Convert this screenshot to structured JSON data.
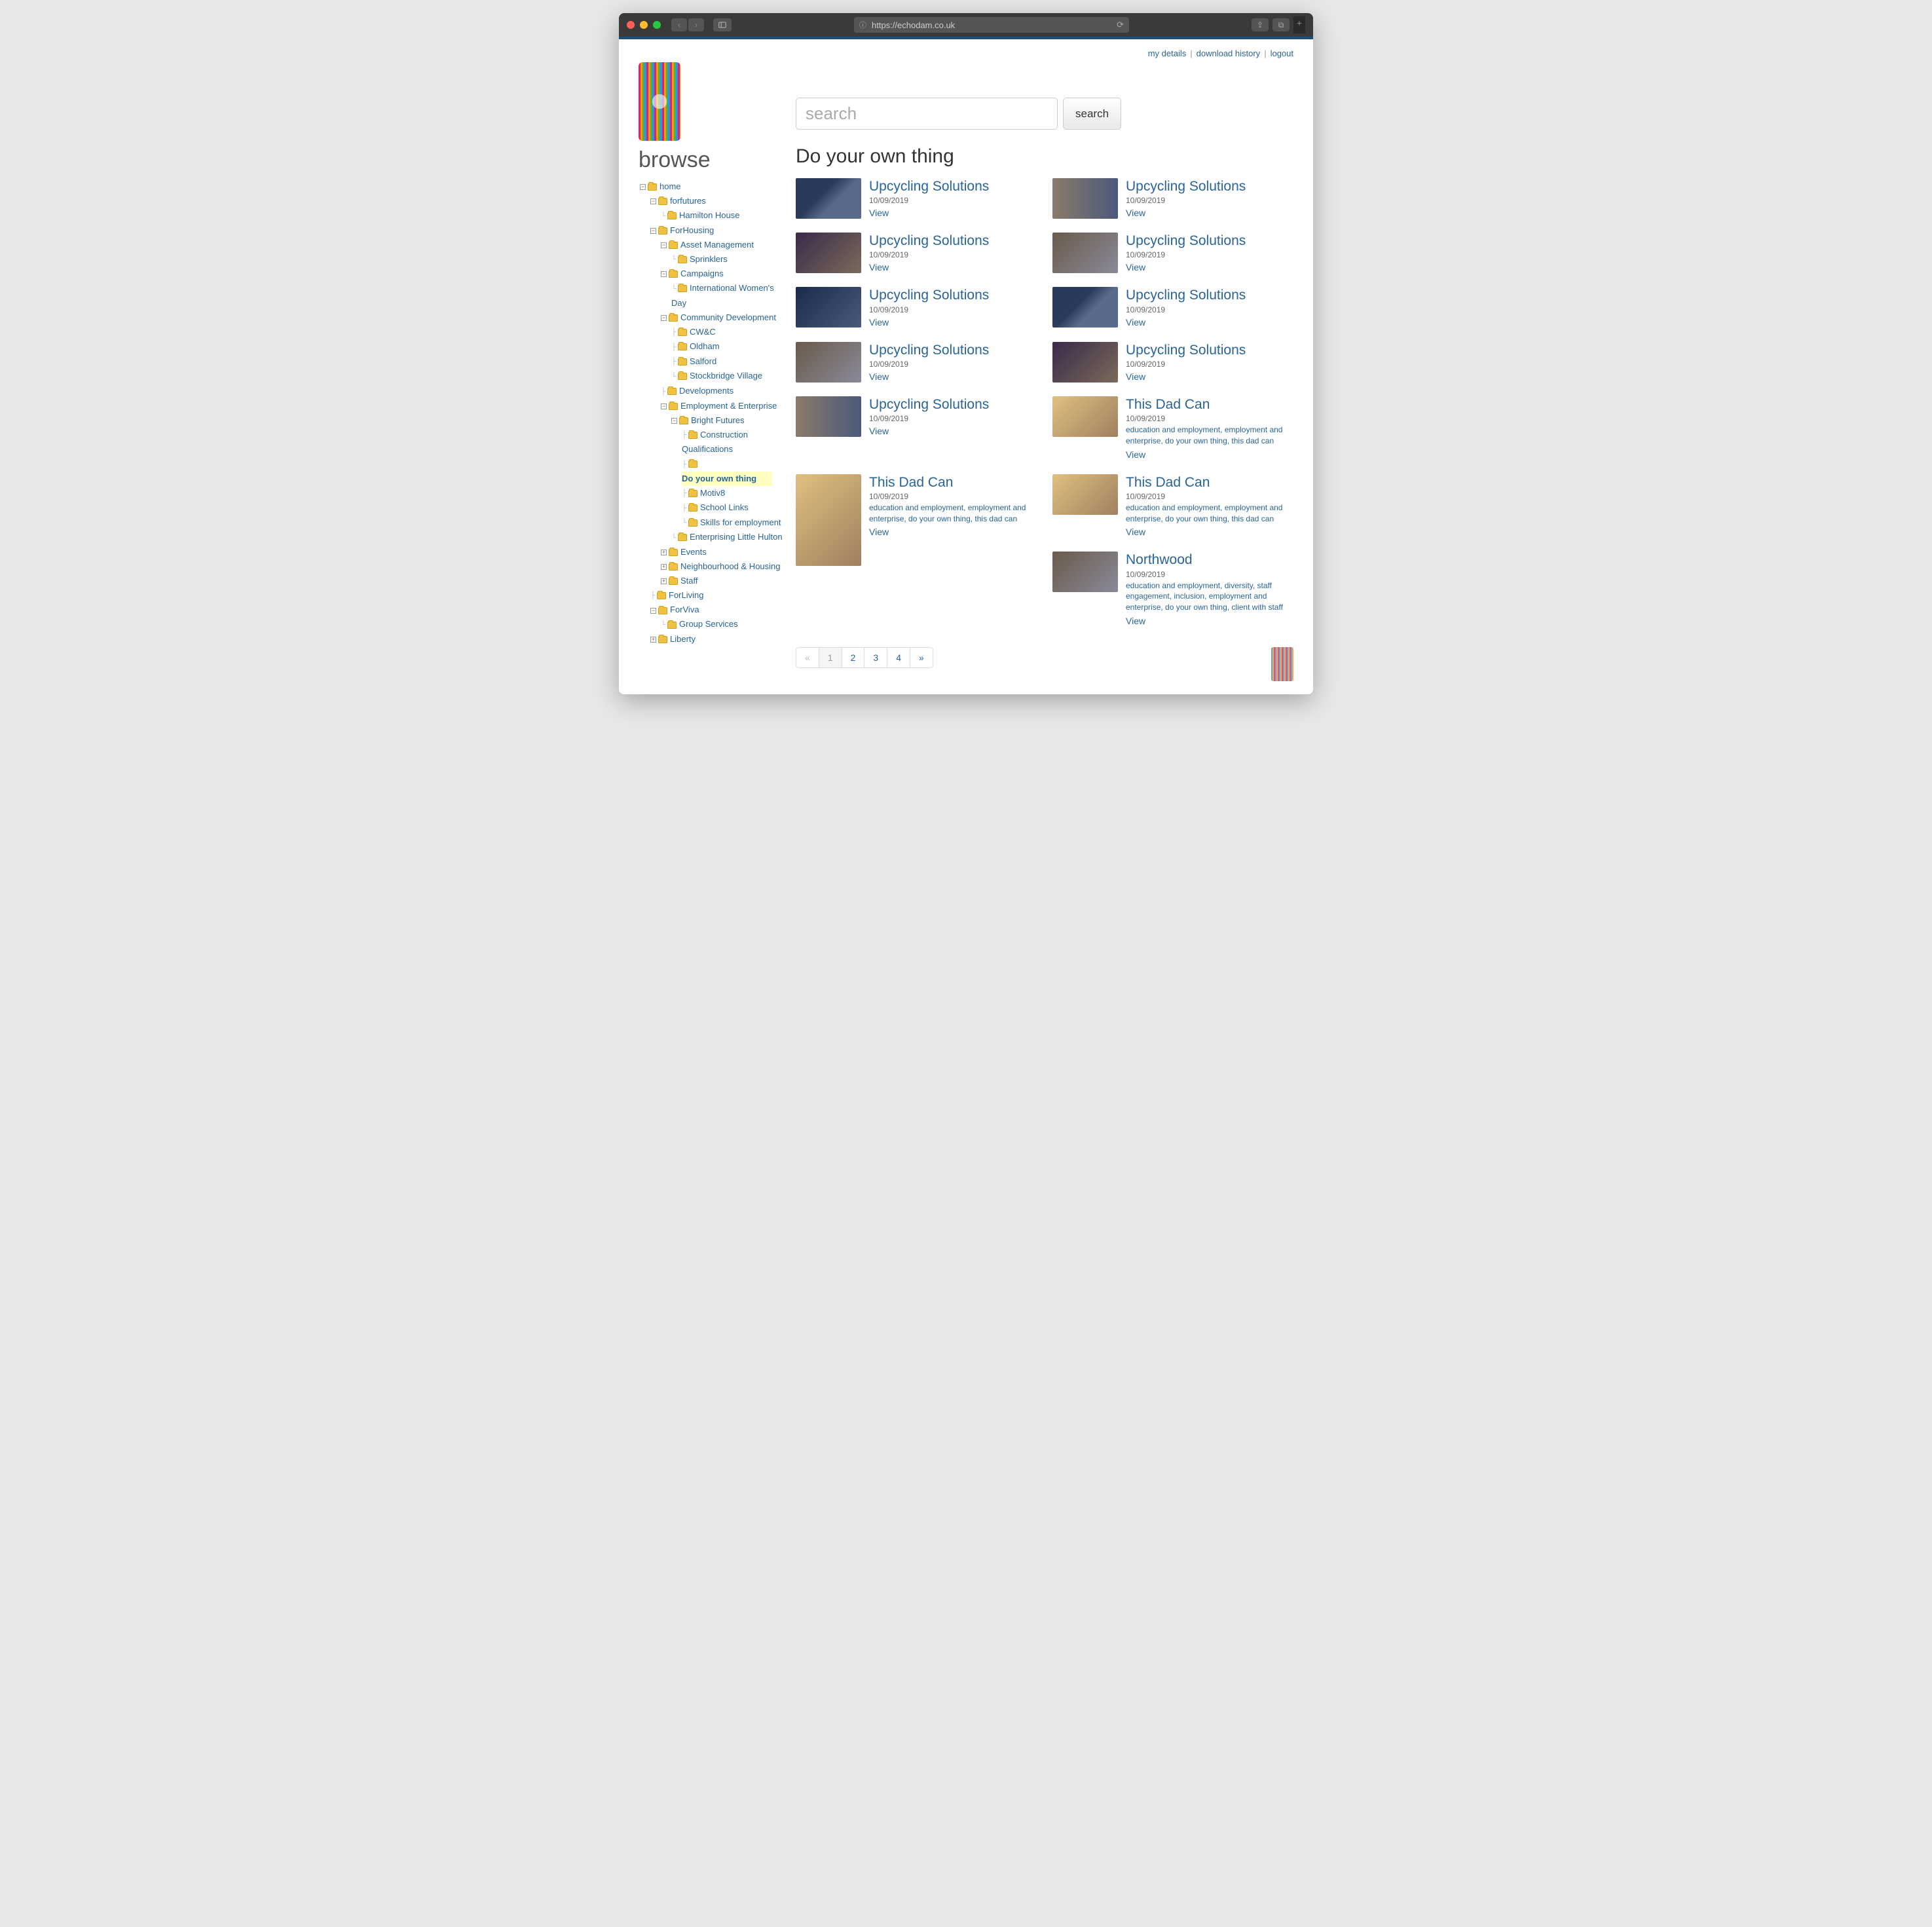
{
  "browser": {
    "url": "https://echodam.co.uk"
  },
  "toplinks": {
    "details": "my details",
    "history": "download history",
    "logout": "logout"
  },
  "sidebar_title": "browse",
  "search": {
    "placeholder": "search",
    "button": "search"
  },
  "page_title": "Do your own thing",
  "tree": {
    "home": "home",
    "forfutures": "forfutures",
    "hamilton": "Hamilton House",
    "forhousing": "ForHousing",
    "asset": "Asset Management",
    "sprinklers": "Sprinklers",
    "campaigns": "Campaigns",
    "iwd": "International Women's Day",
    "community": "Community Development",
    "cwc": "CW&C",
    "oldham": "Oldham",
    "salford": "Salford",
    "stockbridge": "Stockbridge Village",
    "developments": "Developments",
    "employment": "Employment & Enterprise",
    "bright": "Bright Futures",
    "construction": "Construction Qualifications",
    "doyourown": "Do your own thing",
    "motiv8": "Motiv8",
    "schoollinks": "School Links",
    "skills": "Skills for employment",
    "enterprising": "Enterprising Little Hulton",
    "events": "Events",
    "neighbourhood": "Neighbourhood & Housing",
    "staff": "Staff",
    "forliving": "ForLiving",
    "forviva": "ForViva",
    "groupservices": "Group Services",
    "liberty": "Liberty"
  },
  "view_label": "View",
  "tags_full": "education and employment, employment and enterprise, do your own thing, this dad can",
  "tags_northwood": "education and employment, diversity, staff engagement, inclusion, employment and enterprise, do your own thing, client with staff",
  "cards": {
    "c0": {
      "title": "Upcycling Solutions",
      "date": "10/09/2019"
    },
    "c1": {
      "title": "Upcycling Solutions",
      "date": "10/09/2019"
    },
    "c2": {
      "title": "Upcycling Solutions",
      "date": "10/09/2019"
    },
    "c3": {
      "title": "Upcycling Solutions",
      "date": "10/09/2019"
    },
    "c4": {
      "title": "Upcycling Solutions",
      "date": "10/09/2019"
    },
    "c5": {
      "title": "Upcycling Solutions",
      "date": "10/09/2019"
    },
    "c6": {
      "title": "Upcycling Solutions",
      "date": "10/09/2019"
    },
    "c7": {
      "title": "Upcycling Solutions",
      "date": "10/09/2019"
    },
    "c8": {
      "title": "Upcycling Solutions",
      "date": "10/09/2019"
    },
    "c9": {
      "title": "This Dad Can",
      "date": "10/09/2019"
    },
    "c10": {
      "title": "This Dad Can",
      "date": "10/09/2019"
    },
    "c11": {
      "title": "This Dad Can",
      "date": "10/09/2019"
    },
    "c12": {
      "title": "Northwood",
      "date": "10/09/2019"
    }
  },
  "pagination": {
    "prev": "«",
    "p1": "1",
    "p2": "2",
    "p3": "3",
    "p4": "4",
    "next": "»"
  }
}
